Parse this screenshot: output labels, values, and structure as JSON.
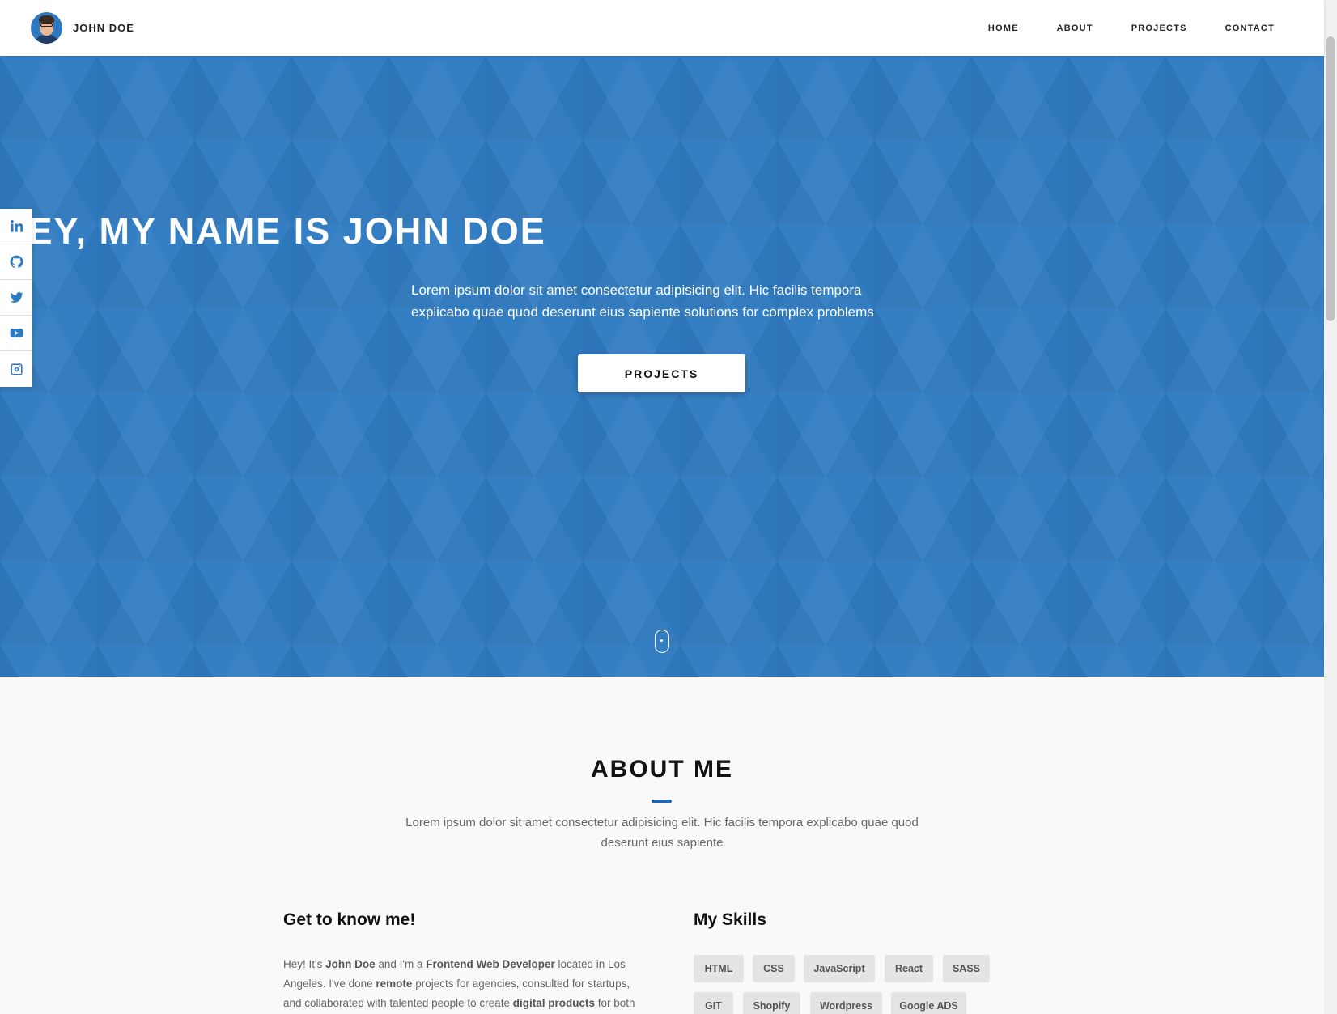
{
  "brand": {
    "name": "JOHN DOE"
  },
  "nav": {
    "items": [
      "HOME",
      "ABOUT",
      "PROJECTS",
      "CONTACT"
    ]
  },
  "social": {
    "icons": [
      "linkedin-icon",
      "github-icon",
      "twitter-icon",
      "youtube-icon",
      "instagram-icon"
    ]
  },
  "hero": {
    "title": "HEY, MY NAME IS JOHN DOE",
    "subtitle": "Lorem ipsum dolor sit amet consectetur adipisicing elit. Hic facilis tempora explicabo quae quod deserunt eius sapiente solutions for complex problems",
    "button": "PROJECTS",
    "background": "#2f7bc2"
  },
  "about": {
    "title": "ABOUT ME",
    "subtitle": "Lorem ipsum dolor sit amet consectetur adipisicing elit. Hic facilis tempora explicabo quae quod deserunt eius sapiente",
    "accent": "#1f63b0",
    "know": {
      "title": "Get to know me!",
      "parts": [
        "Hey! It's ",
        "John Doe",
        " and I'm a ",
        "Frontend Web Developer",
        " located in Los Angeles. I've done ",
        "remote",
        " projects for agencies, consulted for startups, and collaborated with talented people to create ",
        "digital products",
        " for both"
      ]
    },
    "skills": {
      "title": "My Skills",
      "items": [
        "HTML",
        "CSS",
        "JavaScript",
        "React",
        "SASS",
        "GIT",
        "Shopify",
        "Wordpress",
        "Google ADS"
      ]
    }
  }
}
